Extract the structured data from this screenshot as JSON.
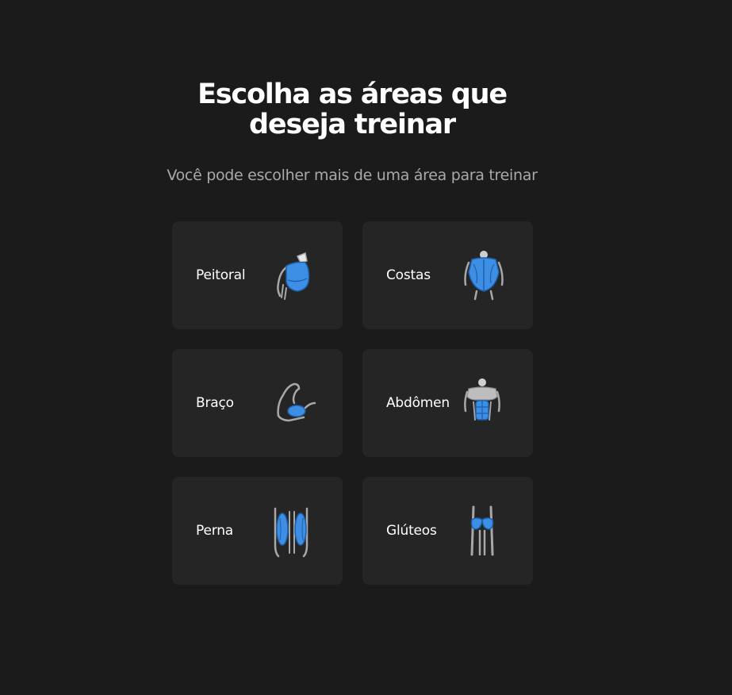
{
  "header": {
    "title": "Escolha as áreas que deseja treinar",
    "subtitle": "Você pode escolher mais de uma área para treinar"
  },
  "areas": [
    {
      "label": "Peitoral",
      "icon": "chest-muscle-icon"
    },
    {
      "label": "Costas",
      "icon": "back-muscle-icon"
    },
    {
      "label": "Braço",
      "icon": "arm-muscle-icon"
    },
    {
      "label": "Abdômen",
      "icon": "abdomen-muscle-icon"
    },
    {
      "label": "Perna",
      "icon": "leg-muscle-icon"
    },
    {
      "label": "Glúteos",
      "icon": "glutes-muscle-icon"
    }
  ],
  "colors": {
    "background": "#1b1b1b",
    "card": "#252525",
    "muscle_highlight": "#3d8fe6",
    "body_outline": "#a8a8a8"
  }
}
